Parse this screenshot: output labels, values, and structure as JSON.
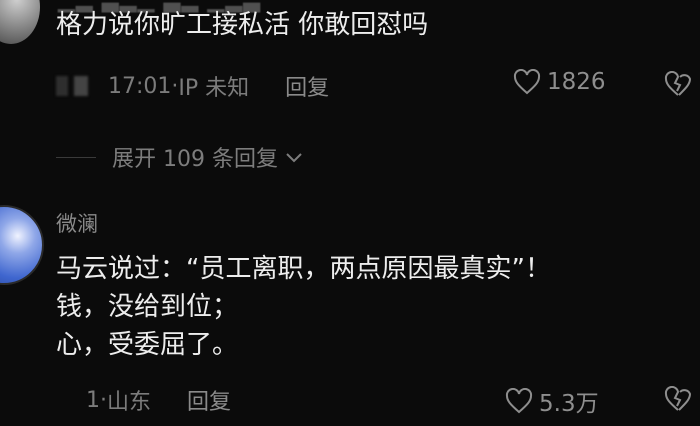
{
  "comments": [
    {
      "text": "格力说你旷工接私活 你敢回怼吗",
      "meta_time": "17:01",
      "meta_sep": "·",
      "meta_ip": "IP 未知",
      "reply_label": "回复",
      "likes": "1826"
    },
    {
      "username": "微澜",
      "text": "马云说过：“员工离职，两点原因最真实”！\n钱，没给到位；\n心，受委屈了。",
      "meta_time": "1",
      "meta_sep": "·",
      "meta_ip": "山东",
      "reply_label": "回复",
      "likes": "5.3万"
    }
  ],
  "expand_replies": "展开 109 条回复",
  "colors": {
    "background": "#0b0b0b",
    "primary_text": "#ededed",
    "secondary_text": "#7c7c7c"
  },
  "icons": [
    "heart-icon",
    "broken-heart-icon",
    "chevron-down-icon",
    "avatar"
  ]
}
